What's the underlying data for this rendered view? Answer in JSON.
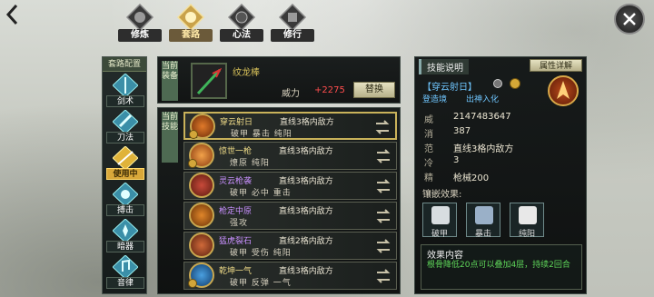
{
  "top_tabs": [
    {
      "label": "修炼",
      "icon": "cultivate-emblem-icon",
      "active": false
    },
    {
      "label": "套路",
      "icon": "routine-emblem-icon",
      "active": true
    },
    {
      "label": "心法",
      "icon": "mind-art-emblem-icon",
      "active": false
    },
    {
      "label": "修行",
      "icon": "practice-emblem-icon",
      "active": false
    }
  ],
  "left_nav": {
    "header": "套路配置",
    "items": [
      {
        "label": "剑术",
        "icon": "sword-icon",
        "active": false
      },
      {
        "label": "刀法",
        "icon": "blade-icon",
        "active": false
      },
      {
        "label": "使用中",
        "icon": "spear-icon",
        "active": true
      },
      {
        "label": "搏击",
        "icon": "fist-icon",
        "active": false
      },
      {
        "label": "暗器",
        "icon": "hidden-weapon-icon",
        "active": false
      },
      {
        "label": "音律",
        "icon": "music-icon",
        "active": false
      }
    ]
  },
  "equipment": {
    "tag": "当前装备",
    "name": "纹龙棒",
    "power_label": "威力",
    "power_value": "+2275",
    "replace_label": "替换"
  },
  "skills": {
    "tag": "当前技能",
    "rows": [
      {
        "name": "穿云射日",
        "range": "直线3格内敌方",
        "tags": "破甲 暴击 纯阳",
        "name_color": "gold",
        "selected": true
      },
      {
        "name": "惊世一枪",
        "range": "直线3格内敌方",
        "tags": "燎原 纯阳",
        "name_color": "gold",
        "selected": false
      },
      {
        "name": "灵云枪袭",
        "range": "直线3格内敌方",
        "tags": "破甲 必中 重击",
        "name_color": "purple",
        "selected": false
      },
      {
        "name": "枪定中原",
        "range": "直线3格内敌方",
        "tags": "强攻",
        "name_color": "purple",
        "selected": false
      },
      {
        "name": "猛虎裂石",
        "range": "直线2格内敌方",
        "tags": "破甲 受伤 纯阳",
        "name_color": "purple",
        "selected": false
      },
      {
        "name": "乾坤一气",
        "range": "直线3格内敌方",
        "tags": "破甲 反弹 一气",
        "name_color": "gold",
        "selected": false
      }
    ]
  },
  "detail": {
    "title": "技能说明",
    "attr_button": "属性详解",
    "name": "【穿云射日】",
    "realm": "登造境",
    "state": "出神入化",
    "stats": [
      {
        "label": "威",
        "value": "2147483647"
      },
      {
        "label": "消",
        "value": "387"
      },
      {
        "label": "范",
        "value": "直线3格内敌方"
      },
      {
        "label": "冷",
        "value": "3"
      },
      {
        "label": "精",
        "value": "枪械200"
      }
    ],
    "inlay_title": "镶嵌效果:",
    "inlays": [
      {
        "label": "破甲",
        "icon": "armor-break-icon"
      },
      {
        "label": "暴击",
        "icon": "critical-strike-icon"
      },
      {
        "label": "纯阳",
        "icon": "pure-yang-icon"
      }
    ],
    "effect_title": "效果内容",
    "effect_text": "根骨降低20点可以叠加4层，持续2回合"
  },
  "colors": {
    "gold": "#f0dc88",
    "purple": "#c990ff",
    "blue": "#6fc6ff",
    "red": "#ff4d4d",
    "green": "#5fd65a"
  }
}
